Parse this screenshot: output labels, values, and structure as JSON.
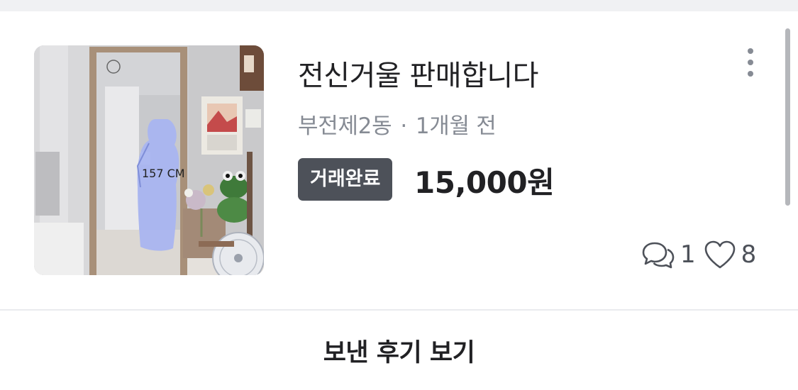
{
  "listing": {
    "title": "전신거울 판매합니다",
    "location": "부전제2동",
    "separator": "·",
    "time_ago": "1개월 전",
    "status_badge": "거래완료",
    "price": "15,000원",
    "chat_count": "1",
    "like_count": "8",
    "photo_marking": "157 CM"
  },
  "footer": {
    "review_label": "보낸 후기 보기"
  },
  "colors": {
    "text_primary": "#212124",
    "text_secondary": "#868b94",
    "badge_bg": "#4d5159",
    "divider": "#eaebee",
    "top_strip": "#f0f1f3"
  },
  "icons": {
    "more": "more-vertical-icon",
    "chat": "chat-bubbles-icon",
    "like": "heart-outline-icon"
  }
}
